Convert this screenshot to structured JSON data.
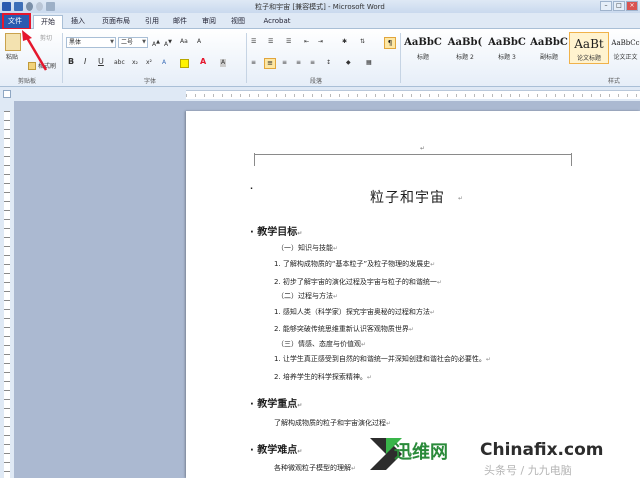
{
  "window": {
    "title": "粒子和宇宙 [兼容模式] - Microsoft Word",
    "controls": [
      "minimize",
      "maximize",
      "close"
    ]
  },
  "tabs": [
    "文件",
    "开始",
    "插入",
    "页面布局",
    "引用",
    "邮件",
    "审阅",
    "视图",
    "Acrobat"
  ],
  "active_tab": "开始",
  "ribbon": {
    "clipboard": {
      "paste": "粘贴",
      "cut": "剪切",
      "format_painter": "格式刷",
      "group_label": "剪贴板"
    },
    "font": {
      "font_name": "黑体",
      "font_size": "二号",
      "group_label": "字体",
      "bold": "B",
      "italic": "I",
      "underline": "U"
    },
    "paragraph": {
      "group_label": "段落"
    },
    "styles": {
      "group_label": "样式",
      "items": [
        {
          "sample": "AaBbC",
          "name": "标题"
        },
        {
          "sample": "AaBb(",
          "name": "标题 2"
        },
        {
          "sample": "AaBbC",
          "name": "标题 3"
        },
        {
          "sample": "AaBbC",
          "name": "副标题"
        },
        {
          "sample": "AaBt",
          "name": "论文标题"
        },
        {
          "sample": "AaBbCc",
          "name": "论文正文"
        }
      ]
    }
  },
  "document": {
    "title": "粒子和宇宙",
    "paragraph_mark": "↵",
    "sections": [
      {
        "heading": "教学目标",
        "lines": [
          "（一）知识与技能",
          "1.  了解构成物质的“基本粒子”及粒子物理的发展史",
          "2.  初步了解宇宙的演化过程及宇宙与粒子的和谐统一",
          "（二）过程与方法",
          "1.  感知人类（科学家）探究宇宙奥秘的过程和方法",
          "2.  能够突破传统思维重新认识客观物质世界",
          "（三）情感、态度与价值观",
          "1.  让学生真正感受到自然的和谐统一并深知创建和谐社会的必要性。",
          "2.  培养学生的科学探索精神。"
        ]
      },
      {
        "heading": "教学重点",
        "lines": [
          "了解构成物质的粒子和宇宙演化过程"
        ]
      },
      {
        "heading": "教学难点",
        "lines": [
          "各种微观粒子模型的理解"
        ]
      }
    ]
  },
  "watermarks": {
    "brand1": "迅维网",
    "brand2": "Chinafix.com",
    "overlay": "头条号 / 九九电脑"
  },
  "colors": {
    "file_tab": "#2a5ab0",
    "highlight": "#e5172d",
    "ribbon_bg": "#dfe9f5",
    "workspace": "#abb9d1"
  }
}
